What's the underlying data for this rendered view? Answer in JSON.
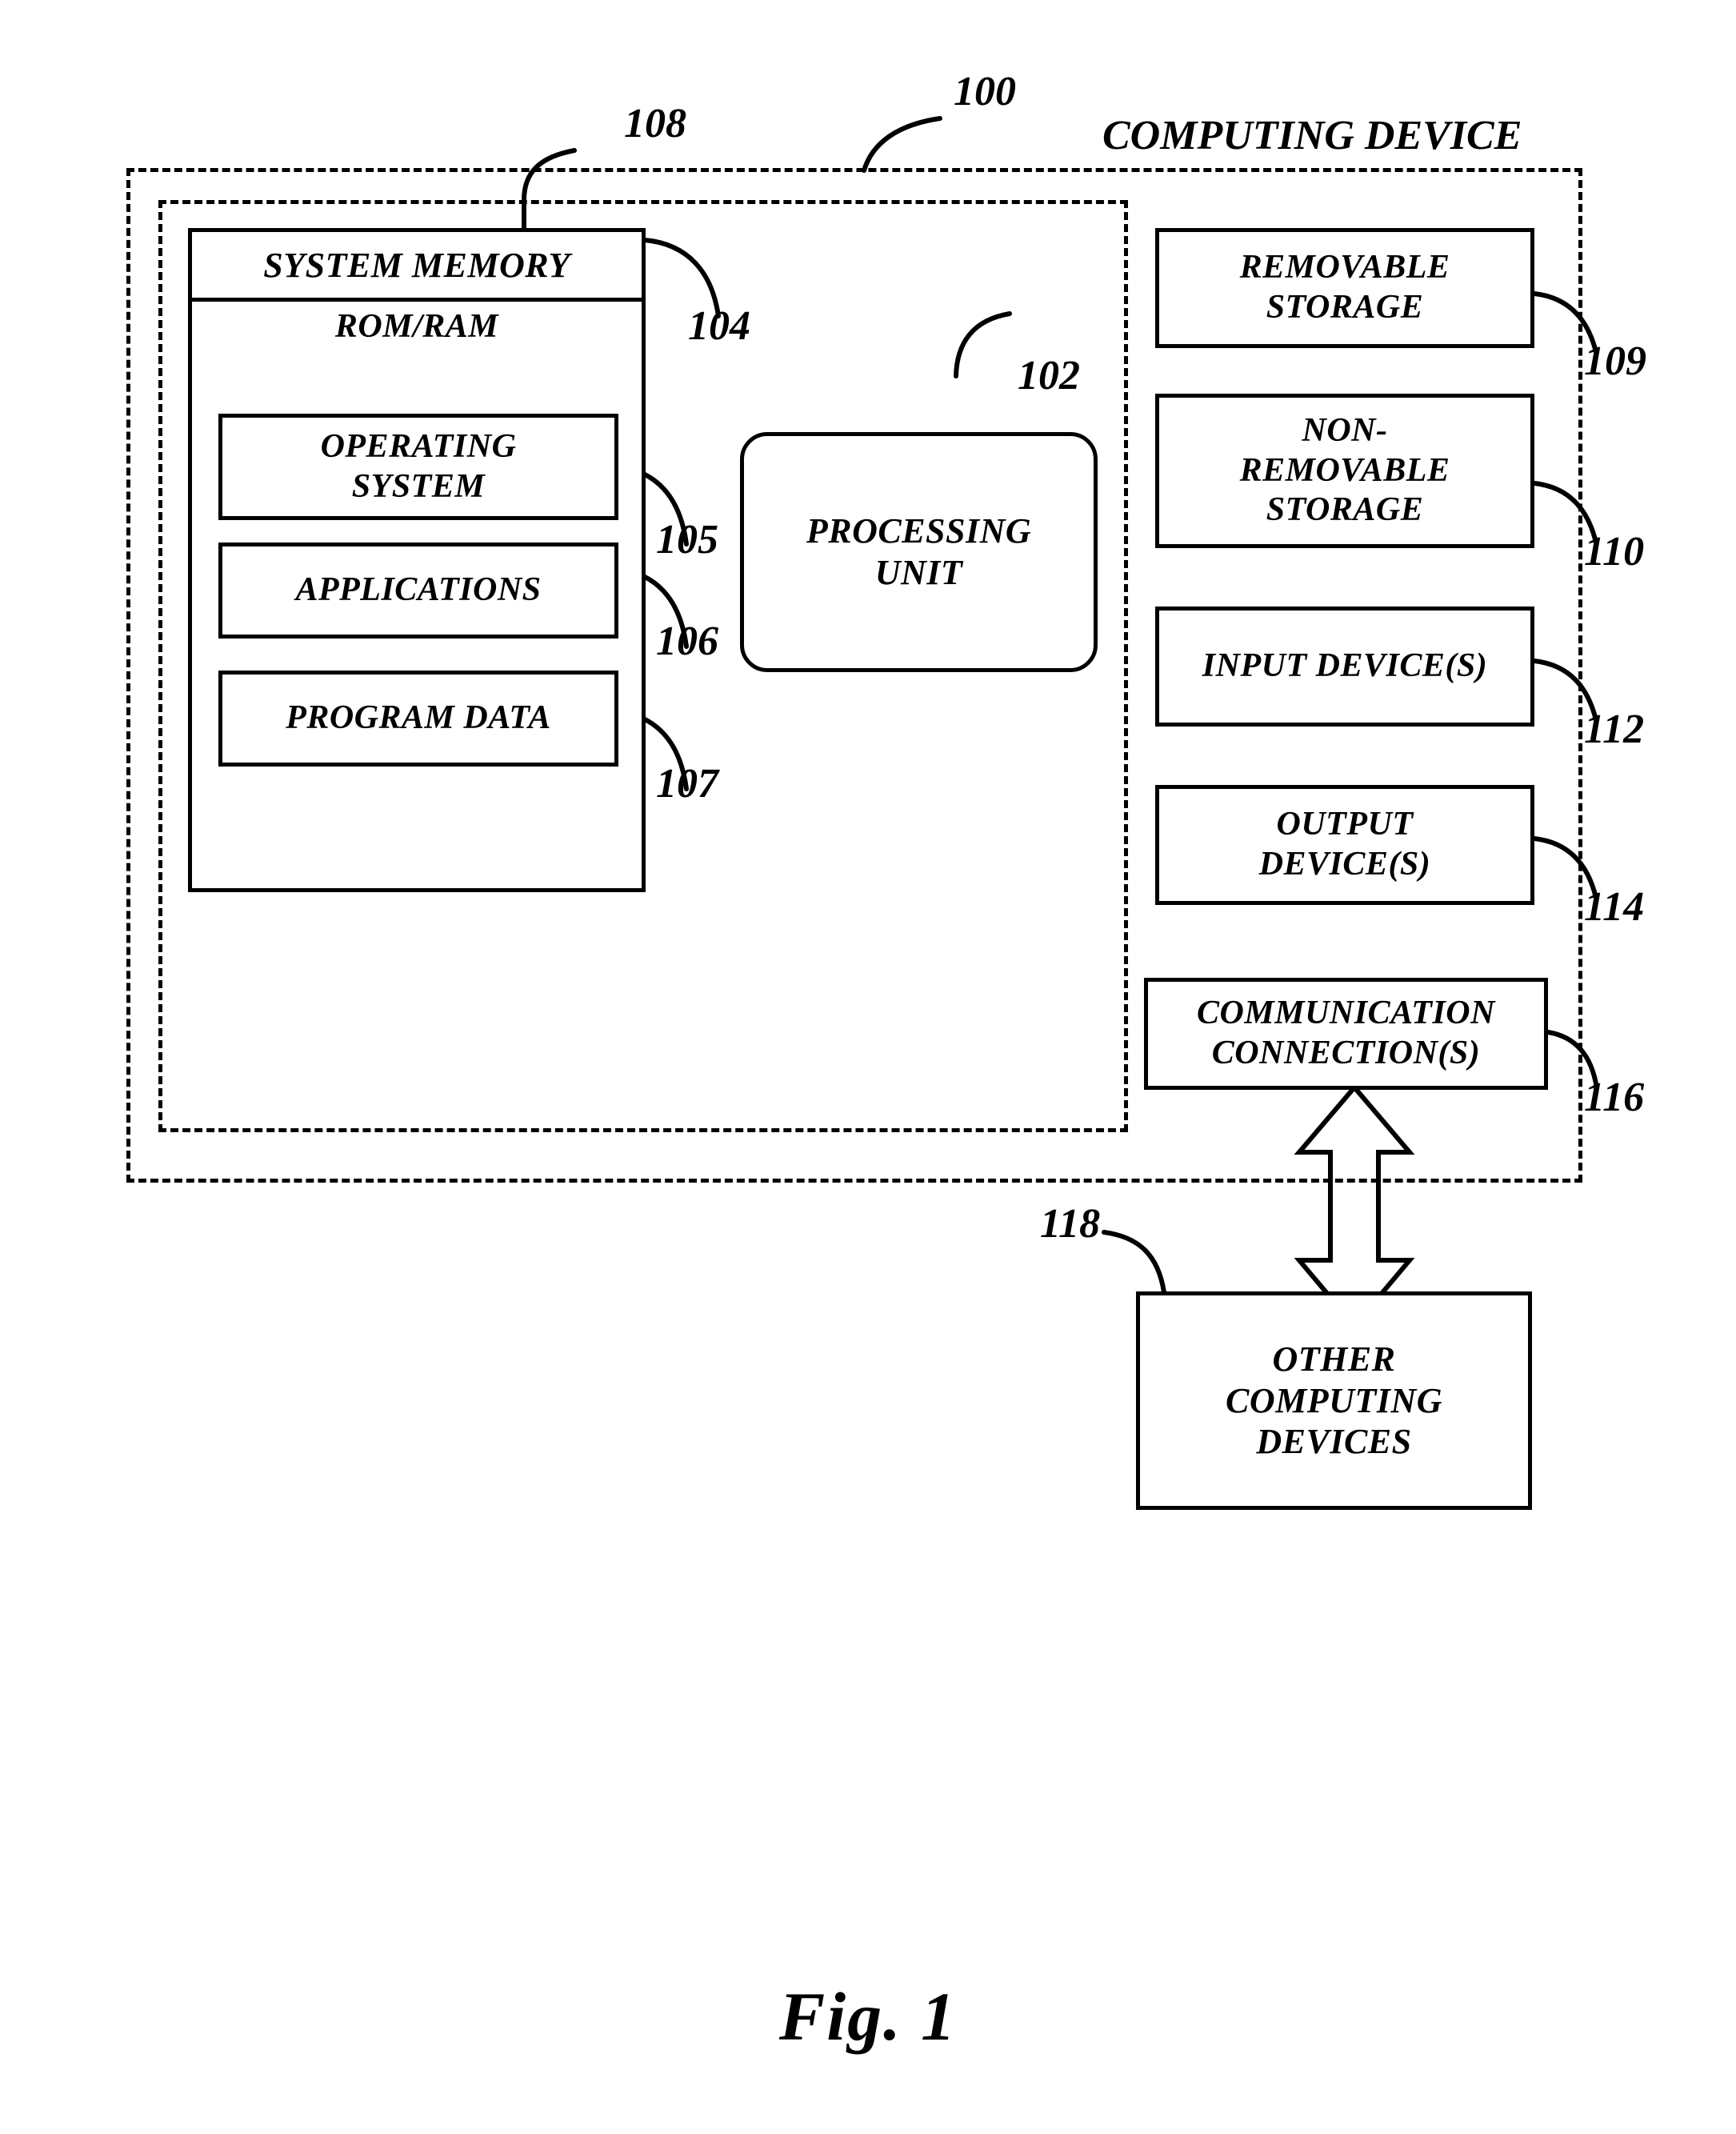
{
  "figure": {
    "caption": "Fig. 1",
    "title": "COMPUTING DEVICE"
  },
  "enclosures": {
    "computing_device": {
      "label": "COMPUTING DEVICE",
      "ref": "100",
      "style": "dashed"
    },
    "basic_configuration": {
      "ref": "108",
      "style": "dashed"
    }
  },
  "blocks": {
    "system_memory": {
      "title": "SYSTEM MEMORY",
      "subtitle": "ROM/RAM",
      "ref": "104"
    },
    "operating_system": {
      "label": "OPERATING SYSTEM",
      "line1": "OPERATING",
      "line2": "SYSTEM",
      "ref": "105"
    },
    "applications": {
      "label": "APPLICATIONS",
      "ref": "106"
    },
    "program_data": {
      "label": "PROGRAM DATA",
      "ref": "107"
    },
    "processing_unit": {
      "label": "PROCESSING UNIT",
      "line1": "PROCESSING",
      "line2": "UNIT",
      "ref": "102"
    },
    "removable_storage": {
      "label": "REMOVABLE STORAGE",
      "line1": "REMOVABLE",
      "line2": "STORAGE",
      "ref": "109"
    },
    "non_removable_storage": {
      "label": "NON-REMOVABLE STORAGE",
      "line1": "NON-",
      "line2": "REMOVABLE",
      "line3": "STORAGE",
      "ref": "110"
    },
    "input_devices": {
      "label": "INPUT DEVICE(S)",
      "ref": "112"
    },
    "output_devices": {
      "label": "OUTPUT DEVICE(S)",
      "line1": "OUTPUT",
      "line2": "DEVICE(S)",
      "ref": "114"
    },
    "communication_connections": {
      "label": "COMMUNICATION CONNECTION(S)",
      "line1": "COMMUNICATION",
      "line2": "CONNECTION(S)",
      "ref": "116"
    },
    "other_computing_devices": {
      "label": "OTHER COMPUTING DEVICES",
      "line1": "OTHER",
      "line2": "COMPUTING",
      "line3": "DEVICES",
      "ref": "118"
    }
  },
  "connectors": {
    "comm_to_other_devices": {
      "type": "double-headed-arrow",
      "direction": "vertical"
    }
  },
  "colors": {
    "stroke": "#000000",
    "background": "#ffffff"
  }
}
